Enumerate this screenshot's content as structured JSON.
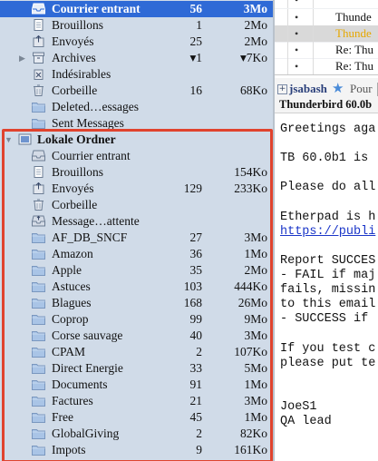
{
  "folders_top": [
    {
      "name": "Courrier entrant",
      "unread": "56",
      "size": "3Mo",
      "icon": "inbox-icon",
      "selected": true
    },
    {
      "name": "Brouillons",
      "unread": "1",
      "size": "2Mo",
      "icon": "drafts-icon"
    },
    {
      "name": "Envoyés",
      "unread": "25",
      "size": "2Mo",
      "icon": "sent-icon"
    },
    {
      "name": "Archives",
      "unread": "▾1",
      "size": "▾7Ko",
      "icon": "archive-icon",
      "twisty": "▶"
    },
    {
      "name": "Indésirables",
      "unread": "",
      "size": "",
      "icon": "junk-icon"
    },
    {
      "name": "Corbeille",
      "unread": "16",
      "size": "68Ko",
      "icon": "trash-icon"
    },
    {
      "name": "Deleted…essages",
      "unread": "",
      "size": "",
      "icon": "folder-icon"
    },
    {
      "name": "Sent Messages",
      "unread": "",
      "size": "",
      "icon": "folder-icon"
    }
  ],
  "local_account": {
    "name": "Lokale Ordner",
    "twisty": "▼"
  },
  "folders_local": [
    {
      "name": "Courrier entrant",
      "unread": "",
      "size": "",
      "icon": "inbox-icon"
    },
    {
      "name": "Brouillons",
      "unread": "",
      "size": "154Ko",
      "icon": "drafts-icon"
    },
    {
      "name": "Envoyés",
      "unread": "129",
      "size": "233Ko",
      "icon": "sent-icon"
    },
    {
      "name": "Corbeille",
      "unread": "",
      "size": "",
      "icon": "trash-icon"
    },
    {
      "name": "Message…attente",
      "unread": "",
      "size": "",
      "icon": "outbox-icon"
    },
    {
      "name": "AF_DB_SNCF",
      "unread": "27",
      "size": "3Mo",
      "icon": "folder-icon"
    },
    {
      "name": "Amazon",
      "unread": "36",
      "size": "1Mo",
      "icon": "folder-icon"
    },
    {
      "name": "Apple",
      "unread": "35",
      "size": "2Mo",
      "icon": "folder-icon"
    },
    {
      "name": "Astuces",
      "unread": "103",
      "size": "444Ko",
      "icon": "folder-icon"
    },
    {
      "name": "Blagues",
      "unread": "168",
      "size": "26Mo",
      "icon": "folder-icon"
    },
    {
      "name": "Coprop",
      "unread": "99",
      "size": "9Mo",
      "icon": "folder-icon"
    },
    {
      "name": "Corse sauvage",
      "unread": "40",
      "size": "3Mo",
      "icon": "folder-icon"
    },
    {
      "name": "CPAM",
      "unread": "2",
      "size": "107Ko",
      "icon": "folder-icon"
    },
    {
      "name": "Direct Energie",
      "unread": "33",
      "size": "5Mo",
      "icon": "folder-icon"
    },
    {
      "name": "Documents",
      "unread": "91",
      "size": "1Mo",
      "icon": "folder-icon"
    },
    {
      "name": "Factures",
      "unread": "21",
      "size": "3Mo",
      "icon": "folder-icon"
    },
    {
      "name": "Free",
      "unread": "45",
      "size": "1Mo",
      "icon": "folder-icon"
    },
    {
      "name": "GlobalGiving",
      "unread": "2",
      "size": "82Ko",
      "icon": "folder-icon"
    },
    {
      "name": "Impots",
      "unread": "9",
      "size": "161Ko",
      "icon": "folder-icon"
    }
  ],
  "threads": [
    {
      "subject": "",
      "selected": false
    },
    {
      "subject": "Thunde",
      "selected": false
    },
    {
      "subject": "Thunde",
      "selected": true
    },
    {
      "subject": "Re: Thu",
      "selected": false
    },
    {
      "subject": "Re: Thu",
      "selected": false
    }
  ],
  "message": {
    "from": "jsabash",
    "pour_label": "Pour",
    "subject": "Thunderbird 60.0b",
    "body_lines": [
      {
        "text": "Greetings aga",
        "link": false
      },
      {
        "text": "",
        "link": false
      },
      {
        "text": "TB 60.0b1 is",
        "link": false
      },
      {
        "text": "",
        "link": false
      },
      {
        "text": "Please do all",
        "link": false
      },
      {
        "text": "",
        "link": false
      },
      {
        "text": "Etherpad is h",
        "link": false
      },
      {
        "text": "https://publi",
        "link": true
      },
      {
        "text": "",
        "link": false
      },
      {
        "text": "Report SUCCES",
        "link": false
      },
      {
        "text": "- FAIL if maj",
        "link": false
      },
      {
        "text": "fails, missin",
        "link": false
      },
      {
        "text": "to this email",
        "link": false
      },
      {
        "text": "- SUCCESS if",
        "link": false
      },
      {
        "text": "",
        "link": false
      },
      {
        "text": "If you test c",
        "link": false
      },
      {
        "text": "please put te",
        "link": false
      },
      {
        "text": "",
        "link": false
      },
      {
        "text": "",
        "link": false
      },
      {
        "text": "JoeS1",
        "link": false
      },
      {
        "text": "QA lead",
        "link": false
      }
    ]
  },
  "colors": {
    "selection": "#2f6ad6",
    "pane": "#d0dbe8",
    "highlight": "#e0432e",
    "link": "#1a35c8"
  }
}
